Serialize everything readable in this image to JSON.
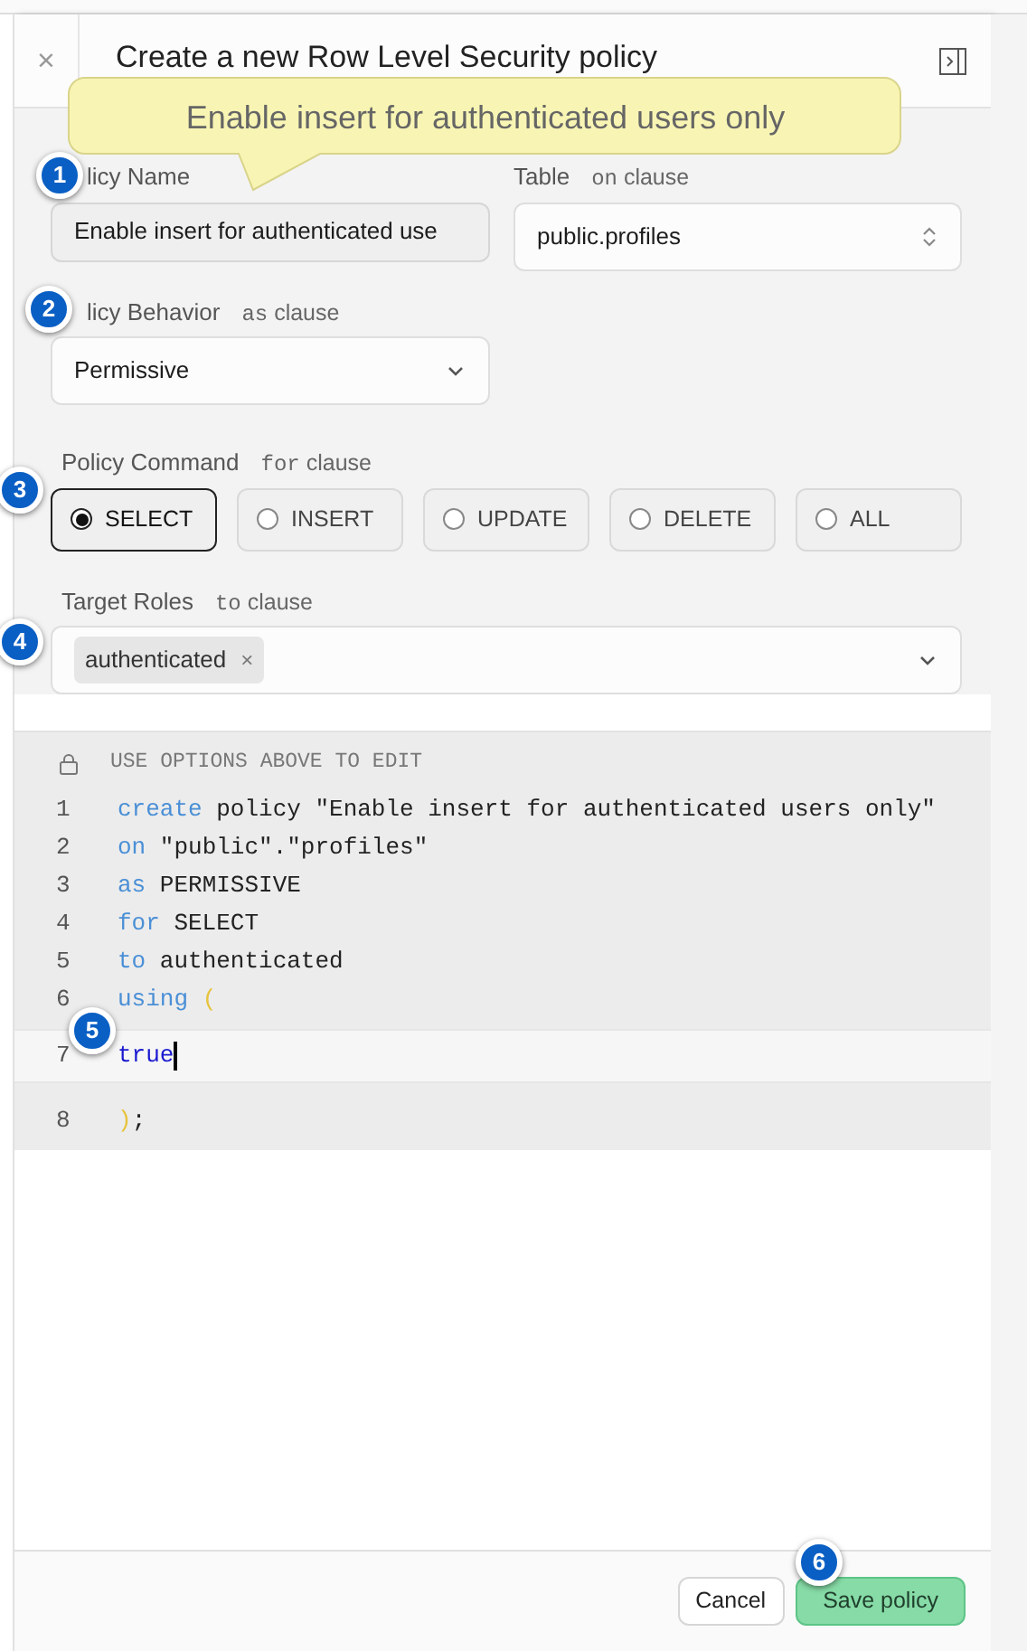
{
  "header": {
    "close": "×",
    "title": "Create a new Row Level Security policy"
  },
  "tooltip": {
    "text": "Enable insert for authenticated users only"
  },
  "form": {
    "policy_name": {
      "label": "licy Name",
      "value": "Enable insert for authenticated use"
    },
    "table": {
      "label": "Table",
      "hint": "on clause",
      "value": "public.profiles"
    },
    "behavior": {
      "label": "licy Behavior",
      "hint": "as clause",
      "value": "Permissive"
    },
    "command": {
      "label": "Policy Command",
      "hint": "for clause",
      "options": [
        {
          "label": "SELECT",
          "selected": true
        },
        {
          "label": "INSERT",
          "selected": false
        },
        {
          "label": "UPDATE",
          "selected": false
        },
        {
          "label": "DELETE",
          "selected": false
        },
        {
          "label": "ALL",
          "selected": false
        }
      ]
    },
    "roles": {
      "label": "Target Roles",
      "hint": "to clause",
      "tags": [
        {
          "label": "authenticated",
          "remove": "×"
        }
      ]
    }
  },
  "editor": {
    "notice": "USE OPTIONS ABOVE TO EDIT",
    "lines": [
      {
        "number": "1",
        "active": false,
        "tokens": [
          {
            "kind": "keyword",
            "text": "create"
          },
          {
            "kind": "plain",
            "text": " policy \"Enable insert for authenticated users only\""
          }
        ]
      },
      {
        "number": "2",
        "active": false,
        "tokens": [
          {
            "kind": "keyword",
            "text": "on"
          },
          {
            "kind": "plain",
            "text": " \"public\".\"profiles\""
          }
        ]
      },
      {
        "number": "3",
        "active": false,
        "tokens": [
          {
            "kind": "keyword",
            "text": "as"
          },
          {
            "kind": "plain",
            "text": " PERMISSIVE"
          }
        ]
      },
      {
        "number": "4",
        "active": false,
        "tokens": [
          {
            "kind": "keyword",
            "text": "for"
          },
          {
            "kind": "plain",
            "text": " SELECT"
          }
        ]
      },
      {
        "number": "5",
        "active": false,
        "tokens": [
          {
            "kind": "keyword",
            "text": "to"
          },
          {
            "kind": "plain",
            "text": " authenticated"
          }
        ]
      },
      {
        "number": "6",
        "active": false,
        "tokens": [
          {
            "kind": "keyword",
            "text": "using"
          },
          {
            "kind": "paren",
            "text": " ("
          }
        ]
      },
      {
        "number": "7",
        "active": true,
        "tokens": [
          {
            "kind": "literal",
            "text": "true"
          }
        ]
      },
      {
        "number": "8",
        "active": false,
        "tokens": [
          {
            "kind": "paren",
            "text": ")"
          },
          {
            "kind": "plain",
            "text": ";"
          }
        ]
      }
    ]
  },
  "footer": {
    "buttons": [
      {
        "label": "Cancel",
        "kind": "secondary"
      },
      {
        "label": "Save policy",
        "kind": "primary"
      }
    ]
  },
  "callouts": [
    "1",
    "2",
    "3",
    "4",
    "5",
    "6"
  ]
}
